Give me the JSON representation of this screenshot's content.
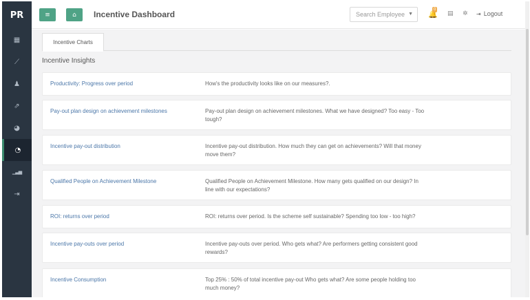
{
  "brand": "PR",
  "sidebar": {
    "items": [
      {
        "icon": "dashboard-icon",
        "glyph": "▦"
      },
      {
        "icon": "line-chart-icon",
        "glyph": "⟋"
      },
      {
        "icon": "sitemap-icon",
        "glyph": "♟"
      },
      {
        "icon": "external-link-icon",
        "glyph": "⇗"
      },
      {
        "icon": "pie-chart-icon",
        "glyph": "◕"
      },
      {
        "icon": "pie-chart-active-icon",
        "glyph": "◔"
      },
      {
        "icon": "bar-chart-icon",
        "glyph": "▁▃▅"
      },
      {
        "icon": "sign-out-icon",
        "glyph": "⇥"
      }
    ],
    "active_index": 5
  },
  "header": {
    "menu_glyph": "≡",
    "home_glyph": "⌂",
    "title": "Incentive Dashboard",
    "search_placeholder": "Search Employee",
    "caret": "▼",
    "bell_glyph": "🔔",
    "notification_count": "0",
    "card_glyph": "▤",
    "gear_glyph": "✲",
    "logout_glyph": "⇥",
    "logout_label": "Logout"
  },
  "tabs": [
    {
      "label": "Incentive Charts"
    }
  ],
  "section_title": "Incentive Insights",
  "insights": [
    {
      "name": "Productivity: Progress over period",
      "description": "How's the productivity looks like on our measures?."
    },
    {
      "name": "Pay-out plan design on achievement milestones",
      "description": "Pay-out plan design on achievement milestones. What we have designed? Too easy - Too tough?"
    },
    {
      "name": "Incentive pay-out distribution",
      "description": "Incentive pay-out distribution. How much they can get on achievements? Will that money move them?"
    },
    {
      "name": "Qualified People on Achievement Milestone",
      "description": "Qualified People on Achievement Milestone. How many gets qualified on our design? In line with our expectations?"
    },
    {
      "name": "ROI: returns over period",
      "description": "ROI: returns over period. Is the scheme self sustainable? Spending too low - too high?"
    },
    {
      "name": "Incentive pay-outs over period",
      "description": "Incentive pay-outs over period. Who gets what? Are performers getting consistent good rewards?"
    },
    {
      "name": "Incentive Consumption",
      "description": "Top 25% : 50% of total incentive pay-out Who gets what? Are some people holding too much money?"
    }
  ],
  "colors": {
    "sidebar": "#2a3541",
    "accent": "#4fa386",
    "link": "#4a76a8"
  }
}
